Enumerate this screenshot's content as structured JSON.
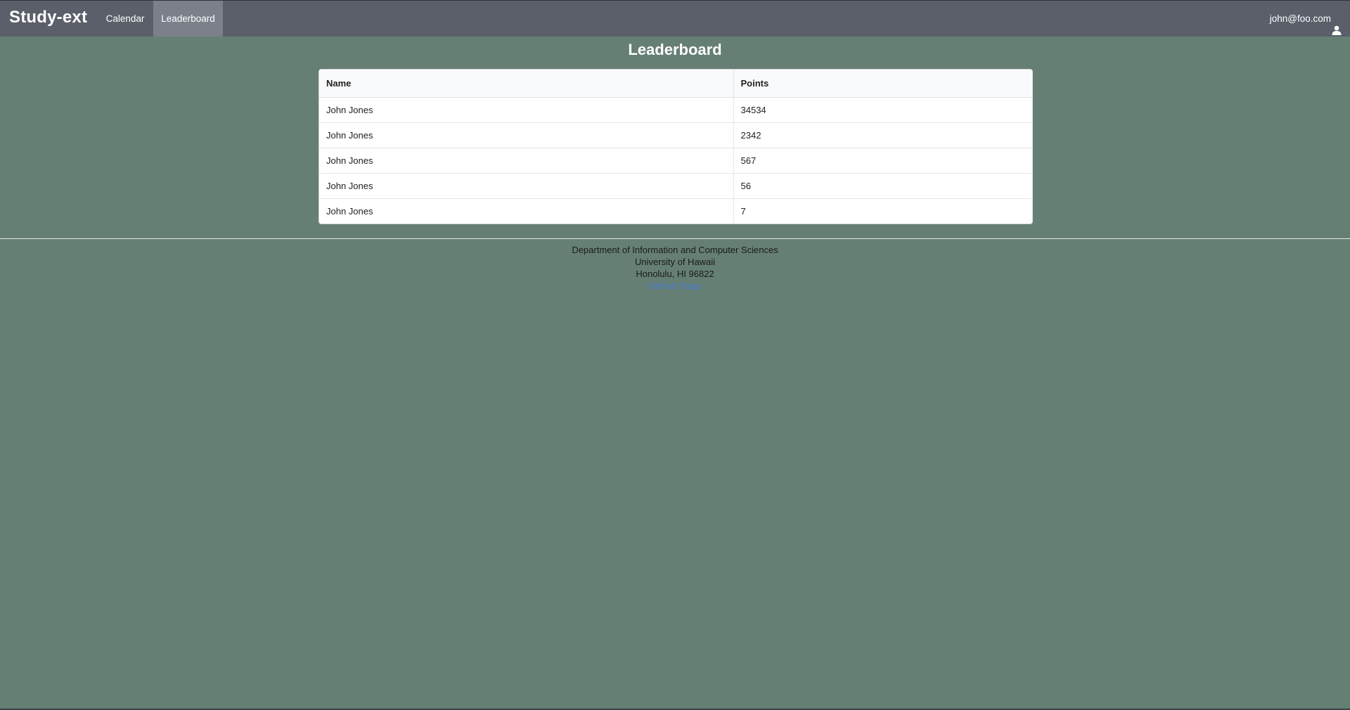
{
  "navbar": {
    "brand": "Study-ext",
    "items": [
      {
        "label": "Calendar",
        "active": false
      },
      {
        "label": "Leaderboard",
        "active": true
      }
    ],
    "user": {
      "email": "john@foo.com",
      "icon": "user-icon"
    }
  },
  "page": {
    "title": "Leaderboard"
  },
  "table": {
    "headers": [
      "Name",
      "Points"
    ],
    "rows": [
      {
        "name": "John Jones",
        "points": "34534"
      },
      {
        "name": "John Jones",
        "points": "2342"
      },
      {
        "name": "John Jones",
        "points": "567"
      },
      {
        "name": "John Jones",
        "points": "56"
      },
      {
        "name": "John Jones",
        "points": "7"
      }
    ]
  },
  "footer": {
    "line1": "Department of Information and Computer Sciences",
    "line2": "University of Hawaii",
    "line3": "Honolulu, HI 96822",
    "link": "GitHub Page"
  },
  "colors": {
    "background": "#667f74",
    "navbar": "#5a5f6a",
    "active_tab": "#7b808b",
    "link": "#4a7fd6"
  }
}
